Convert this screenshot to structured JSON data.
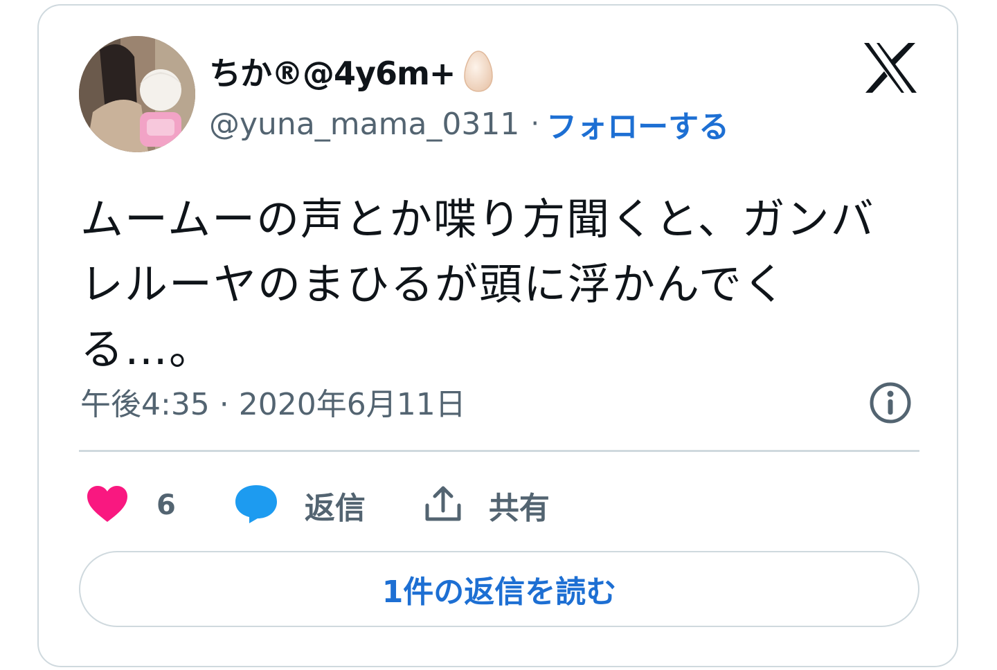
{
  "author": {
    "display_name": "ちか®@4y6m+",
    "handle": "@yuna_mama_0311",
    "separator": "·",
    "follow_label": "フォローする"
  },
  "tweet": {
    "text": "ムームーの声とか喋り方聞くと、ガンバレルーヤのまひるが頭に浮かんでくる…。",
    "timestamp": "午後4:35 · 2020年6月11日"
  },
  "actions": {
    "like_count": "6",
    "reply_label": "返信",
    "share_label": "共有"
  },
  "read_replies_label": "1件の返信を読む",
  "icons": {
    "brand": "x-logo-icon",
    "info": "info-icon",
    "like": "heart-icon",
    "reply": "speech-bubble-icon",
    "share": "share-upload-icon",
    "emoji": "egg-emoji-icon"
  },
  "colors": {
    "link": "#1d6fd3",
    "heart": "#f91880",
    "reply_bubble": "#1d9bf0",
    "muted_text": "#536471",
    "border": "#cfd9de"
  }
}
